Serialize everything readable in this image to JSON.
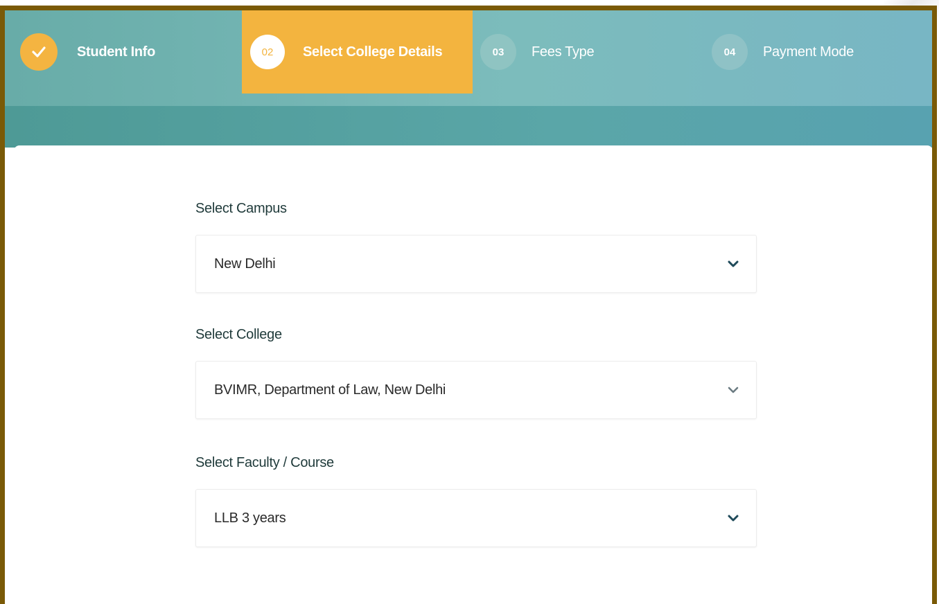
{
  "steps": [
    {
      "number": "",
      "label": "Student Info",
      "state": "done",
      "icon": "check-icon"
    },
    {
      "number": "02",
      "label": "Select College Details",
      "state": "active"
    },
    {
      "number": "03",
      "label": "Fees Type",
      "state": "pending"
    },
    {
      "number": "04",
      "label": "Payment Mode",
      "state": "pending"
    }
  ],
  "form": {
    "campus": {
      "label": "Select Campus",
      "value": "New Delhi",
      "icon": "chevron-down-icon"
    },
    "college": {
      "label": "Select College",
      "value": "BVIMR, Department of Law, New Delhi",
      "icon": "chevron-down-icon"
    },
    "course": {
      "label": "Select Faculty / Course",
      "value": "LLB 3 years",
      "icon": "chevron-down-icon"
    }
  },
  "colors": {
    "accent": "#f3b43f",
    "teal": "#6cb0ac",
    "frame": "#7a5a07"
  }
}
